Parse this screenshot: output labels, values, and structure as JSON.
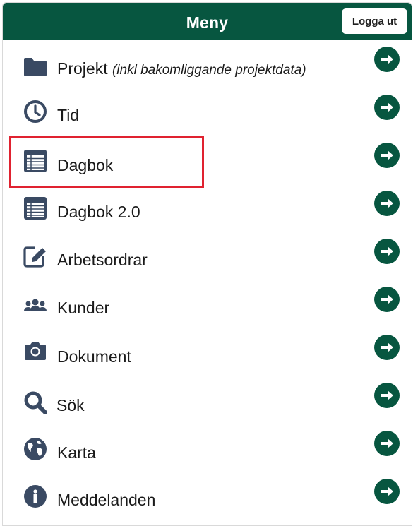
{
  "header": {
    "title": "Meny",
    "logout_label": "Logga ut"
  },
  "menu": {
    "items": [
      {
        "label": "Projekt",
        "note": "(inkl bakomliggande projektdata)",
        "icon": "folder-icon"
      },
      {
        "label": "Tid",
        "icon": "clock-icon"
      },
      {
        "label": "Dagbok",
        "icon": "diary-icon"
      },
      {
        "label": "Dagbok 2.0",
        "icon": "diary-icon"
      },
      {
        "label": "Arbetsordrar",
        "icon": "edit-icon"
      },
      {
        "label": "Kunder",
        "icon": "users-icon"
      },
      {
        "label": "Dokument",
        "icon": "camera-icon"
      },
      {
        "label": "Sök",
        "icon": "search-icon"
      },
      {
        "label": "Karta",
        "icon": "globe-icon"
      },
      {
        "label": "Meddelanden",
        "icon": "info-icon"
      }
    ]
  },
  "colors": {
    "header_bg": "#075640",
    "arrow_bg": "#075640",
    "icon": "#3a4a63",
    "highlight": "#e02230"
  }
}
